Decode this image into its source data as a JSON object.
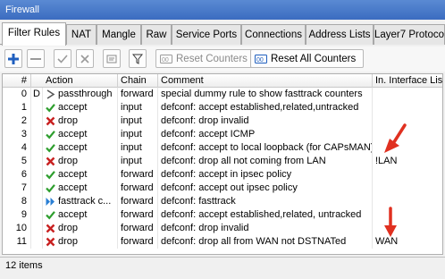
{
  "window": {
    "title": "Firewall"
  },
  "tabs": [
    {
      "label": "Filter Rules",
      "active": true
    },
    {
      "label": "NAT"
    },
    {
      "label": "Mangle"
    },
    {
      "label": "Raw"
    },
    {
      "label": "Service Ports"
    },
    {
      "label": "Connections"
    },
    {
      "label": "Address Lists"
    },
    {
      "label": "Layer7 Protoco"
    }
  ],
  "toolbar": {
    "add_icon": "plus-icon",
    "remove_icon": "minus-icon",
    "enable_icon": "check-icon",
    "disable_icon": "x-icon",
    "comment_icon": "note-icon",
    "filter_icon": "funnel-icon",
    "reset_counters_label": "Reset Counters",
    "reset_all_counters_label": "Reset All Counters"
  },
  "table": {
    "columns": [
      "#",
      "Action",
      "Chain",
      "Comment",
      "In. Interface List"
    ],
    "rows": [
      {
        "num": "0",
        "flag": "D",
        "action": "passthrough",
        "action_icon": "passthrough",
        "chain": "forward",
        "comment": "special dummy rule to show fasttrack counters",
        "in_iface_list": ""
      },
      {
        "num": "1",
        "flag": "",
        "action": "accept",
        "action_icon": "accept",
        "chain": "input",
        "comment": "defconf: accept established,related,untracked",
        "in_iface_list": ""
      },
      {
        "num": "2",
        "flag": "",
        "action": "drop",
        "action_icon": "drop",
        "chain": "input",
        "comment": "defconf: drop invalid",
        "in_iface_list": ""
      },
      {
        "num": "3",
        "flag": "",
        "action": "accept",
        "action_icon": "accept",
        "chain": "input",
        "comment": "defconf: accept ICMP",
        "in_iface_list": ""
      },
      {
        "num": "4",
        "flag": "",
        "action": "accept",
        "action_icon": "accept",
        "chain": "input",
        "comment": "defconf: accept to local loopback (for CAPsMAN)",
        "in_iface_list": ""
      },
      {
        "num": "5",
        "flag": "",
        "action": "drop",
        "action_icon": "drop",
        "chain": "input",
        "comment": "defconf: drop all not coming from LAN",
        "in_iface_list": "!LAN"
      },
      {
        "num": "6",
        "flag": "",
        "action": "accept",
        "action_icon": "accept",
        "chain": "forward",
        "comment": "defconf: accept in ipsec policy",
        "in_iface_list": ""
      },
      {
        "num": "7",
        "flag": "",
        "action": "accept",
        "action_icon": "accept",
        "chain": "forward",
        "comment": "defconf: accept out ipsec policy",
        "in_iface_list": ""
      },
      {
        "num": "8",
        "flag": "",
        "action": "fasttrack c...",
        "action_icon": "fasttrack",
        "chain": "forward",
        "comment": "defconf: fasttrack",
        "in_iface_list": ""
      },
      {
        "num": "9",
        "flag": "",
        "action": "accept",
        "action_icon": "accept",
        "chain": "forward",
        "comment": "defconf: accept established,related, untracked",
        "in_iface_list": ""
      },
      {
        "num": "10",
        "flag": "",
        "action": "drop",
        "action_icon": "drop",
        "chain": "forward",
        "comment": "defconf: drop invalid",
        "in_iface_list": ""
      },
      {
        "num": "11",
        "flag": "",
        "action": "drop",
        "action_icon": "drop",
        "chain": "forward",
        "comment": "defconf: drop all from WAN not DSTNATed",
        "in_iface_list": "WAN"
      }
    ]
  },
  "annotations": [
    {
      "icon": "red-arrow-icon",
      "points_to_row": "5"
    },
    {
      "icon": "red-arrow-icon",
      "points_to_row": "11"
    }
  ],
  "status": {
    "items_count": "12 items"
  },
  "colors": {
    "accept": "#2e9e2e",
    "drop": "#c82020",
    "passthrough": "#555555",
    "fasttrack": "#2a7fd4",
    "arrow": "#e03020",
    "titlebar": "#3b6cc0"
  }
}
